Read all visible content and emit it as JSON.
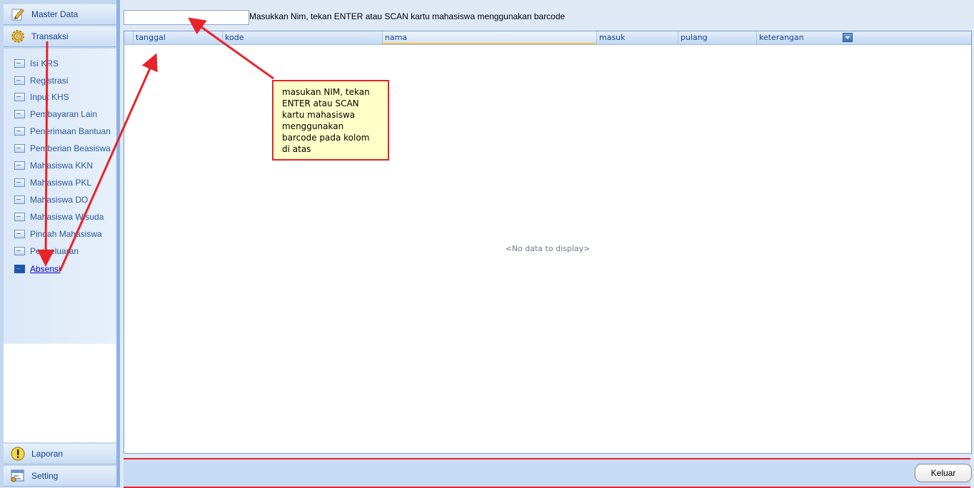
{
  "sidebar": {
    "sections": {
      "master_data": "Master Data",
      "transaksi": "Transaksi",
      "laporan": "Laporan",
      "setting": "Setting"
    },
    "items": [
      {
        "label": "Isi KRS"
      },
      {
        "label": "Registrasi"
      },
      {
        "label": "Input KHS"
      },
      {
        "label": "Pembayaran Lain"
      },
      {
        "label": "Penerimaan Bantuan"
      },
      {
        "label": "Pemberian Beasiswa"
      },
      {
        "label": "Mahasiswa KKN"
      },
      {
        "label": "Mahasiswa PKL"
      },
      {
        "label": "Mahasiswa DO"
      },
      {
        "label": "Mahasiswa Wisuda"
      },
      {
        "label": "Pindah Mahasiswa"
      },
      {
        "label": "Pengeluaran"
      },
      {
        "label": "Absensi",
        "selected": true
      }
    ],
    "icons": {
      "master_data": "pencil-icon",
      "transaksi": "gear-icon",
      "laporan": "exclamation-icon",
      "setting": "settings-window-icon",
      "item": "list-item-icon"
    }
  },
  "toolbar": {
    "nim_input_value": "",
    "nim_hint": "Masukkan Nim, tekan ENTER atau SCAN kartu mahasiswa menggunakan barcode"
  },
  "grid": {
    "columns": [
      "tanggal",
      "kode",
      "nama",
      "masuk",
      "pulang",
      "keterangan"
    ],
    "empty_text": "<No data to display>"
  },
  "footer": {
    "keluar_label": "Keluar"
  },
  "annotation": {
    "lines": [
      "masukan NIM, tekan",
      "ENTER atau SCAN",
      "kartu mahasiswa",
      "menggunakan",
      "barcode pada kolom",
      "di atas"
    ],
    "color": "#e8232a"
  }
}
